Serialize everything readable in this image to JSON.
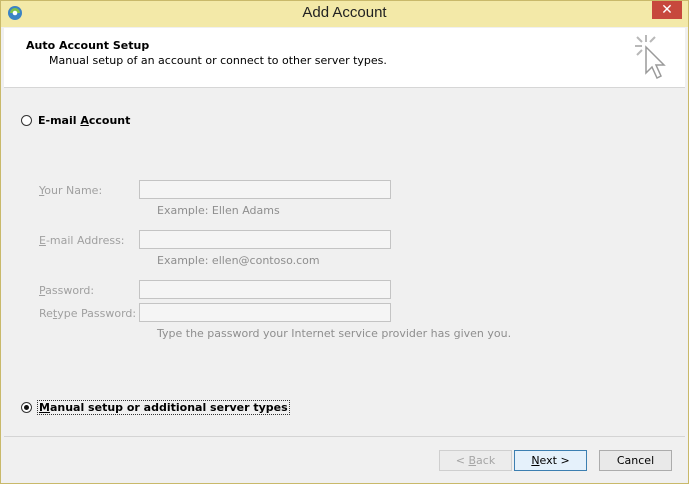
{
  "titlebar": {
    "title": "Add Account",
    "close_glyph": "✕"
  },
  "header": {
    "title": "Auto Account Setup",
    "subtitle": "Manual setup of an account or connect to other server types."
  },
  "email_option": {
    "label_pre": "E-mail ",
    "label_ul": "A",
    "label_post": "ccount",
    "selected": false
  },
  "fields": {
    "name": {
      "label_ul": "Y",
      "label_rest": "our Name:",
      "value": "",
      "hint": "Example: Ellen Adams"
    },
    "email": {
      "label_ul": "E",
      "label_rest": "-mail Address:",
      "value": "",
      "hint": "Example: ellen@contoso.com"
    },
    "password": {
      "label_ul": "P",
      "label_rest": "assword:",
      "value": ""
    },
    "retype": {
      "label_pre": "Re",
      "label_ul": "t",
      "label_rest": "ype Password:",
      "value": "",
      "hint": "Type the password your Internet service provider has given you."
    }
  },
  "manual_option": {
    "label_ul": "M",
    "label_rest": "anual setup or additional server types",
    "selected": true
  },
  "buttons": {
    "back": {
      "pre": "< ",
      "ul": "B",
      "rest": "ack"
    },
    "next": {
      "ul": "N",
      "rest": "ext >"
    },
    "cancel": {
      "label": "Cancel"
    }
  }
}
